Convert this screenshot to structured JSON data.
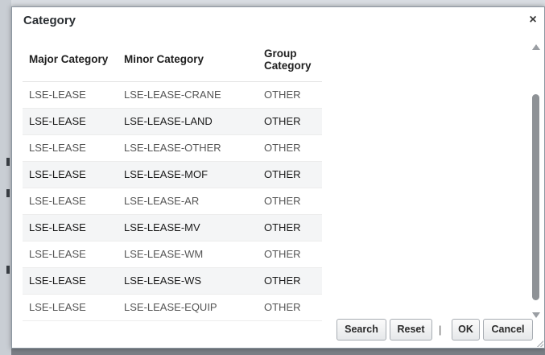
{
  "dialog": {
    "title": "Category",
    "close_label": "×"
  },
  "table": {
    "headers": [
      "Major Category",
      "Minor Category",
      "Group Category"
    ],
    "rows": [
      [
        "LSE-LEASE",
        "LSE-LEASE-CRANE",
        "OTHER"
      ],
      [
        "LSE-LEASE",
        "LSE-LEASE-LAND",
        "OTHER"
      ],
      [
        "LSE-LEASE",
        "LSE-LEASE-OTHER",
        "OTHER"
      ],
      [
        "LSE-LEASE",
        "LSE-LEASE-MOF",
        "OTHER"
      ],
      [
        "LSE-LEASE",
        "LSE-LEASE-AR",
        "OTHER"
      ],
      [
        "LSE-LEASE",
        "LSE-LEASE-MV",
        "OTHER"
      ],
      [
        "LSE-LEASE",
        "LSE-LEASE-WM",
        "OTHER"
      ],
      [
        "LSE-LEASE",
        "LSE-LEASE-WS",
        "OTHER"
      ],
      [
        "LSE-LEASE",
        "LSE-LEASE-EQUIP",
        "OTHER"
      ]
    ]
  },
  "footer": {
    "search_label": "Search",
    "reset_label": "Reset",
    "separator": "|",
    "ok_label": "OK",
    "cancel_label": "Cancel"
  }
}
